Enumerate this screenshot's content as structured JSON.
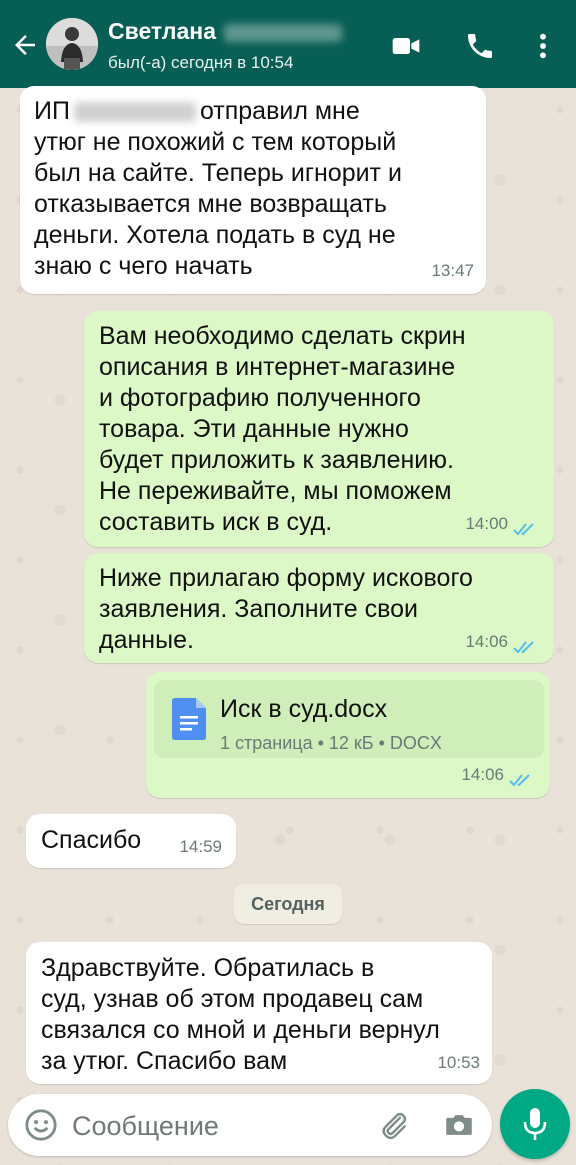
{
  "header": {
    "contact_name": "Светлана",
    "status": "был(-а) сегодня в 10:54"
  },
  "messages": [
    {
      "direction": "in",
      "before": "ИП",
      "after": "отправил мне",
      "text": "утюг не похожий с тем который\nбыл на сайте. Теперь игнорит и\nотказывается мне возвращать\nденьги. Хотела подать в суд не\nзнаю с чего начать",
      "time": "13:47"
    },
    {
      "direction": "out",
      "text": "Вам необходимо сделать скрин\nописания в интернет-магазине\nи фотографию полученного\nтовара. Эти данные нужно\nбудет приложить к заявлению.\nНе переживайте, мы поможем\nсоставить иск в суд.",
      "time": "14:00",
      "status": "read"
    },
    {
      "direction": "out",
      "text": "Ниже прилагаю форму искового\nзаявления. Заполните свои\nданные.",
      "time": "14:06",
      "status": "read"
    },
    {
      "direction": "out",
      "type": "document",
      "file_name": "Иск в суд.docx",
      "file_meta": "1 страница • 12 кБ • DOCX",
      "time": "14:06",
      "status": "read"
    },
    {
      "direction": "in",
      "text": "Спасибо",
      "time": "14:59"
    },
    {
      "direction": "in",
      "text": "Здравствуйте. Обратилась в\nсуд, узнав об этом продавец сам\nсвязался со мной и деньги вернул\nза утюг. Спасибо вам",
      "time": "10:53"
    }
  ],
  "date_separator": "Сегодня",
  "input": {
    "placeholder": "Сообщение"
  },
  "icons": {
    "back": "arrow-left-icon",
    "video": "video-call-icon",
    "call": "phone-icon",
    "menu": "more-vert-icon",
    "emoji": "emoji-icon",
    "attach": "paperclip-icon",
    "camera": "camera-icon",
    "mic": "microphone-icon",
    "document": "document-icon",
    "ticks": "double-check-icon"
  },
  "colors": {
    "header": "#075e54",
    "outgoing": "#dcf8c6",
    "incoming": "#ffffff",
    "read_ticks": "#53bdeb",
    "mic_button": "#00a884"
  }
}
